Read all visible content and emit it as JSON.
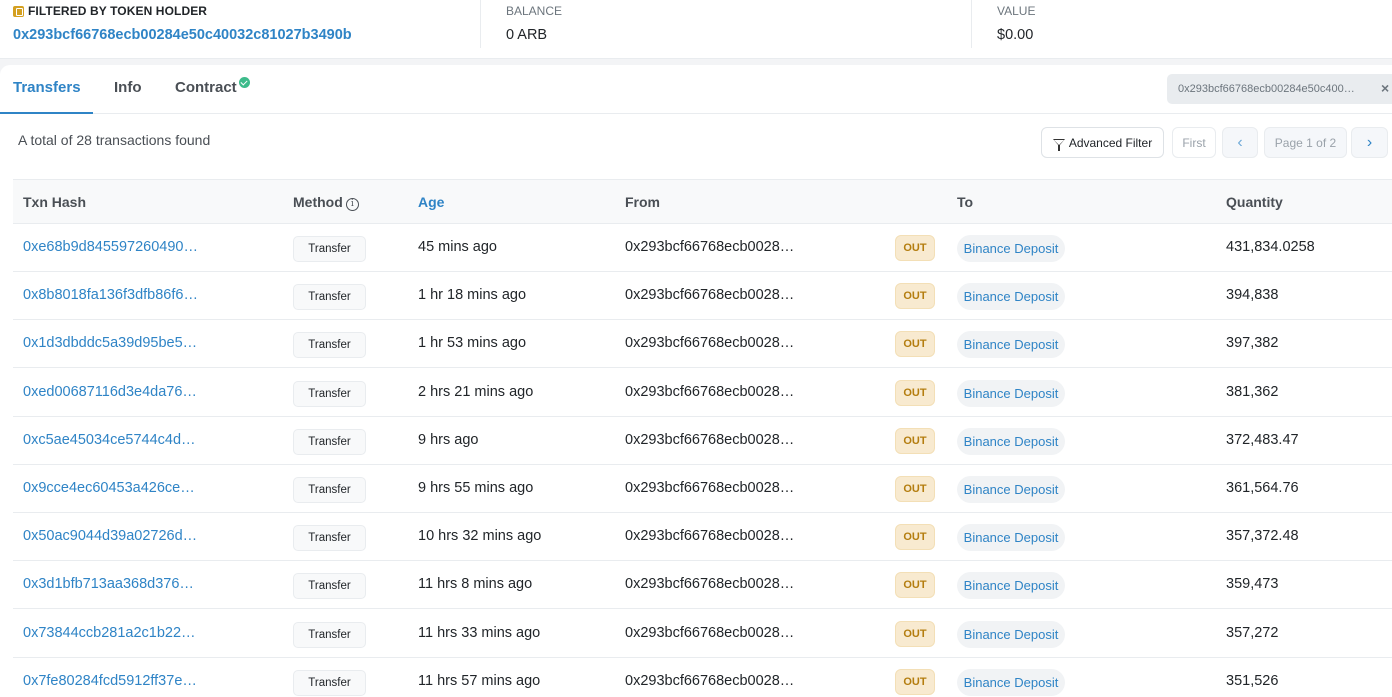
{
  "summary": {
    "holder_label": "FILTERED BY TOKEN HOLDER",
    "holder_address": "0x293bcf66768ecb00284e50c40032c81027b3490b",
    "balance_label": "BALANCE",
    "balance_value": "0 ARB",
    "value_label": "VALUE",
    "value_value": "$0.00"
  },
  "tabs": {
    "transfers": "Transfers",
    "info": "Info",
    "contract": "Contract",
    "active": "Transfers"
  },
  "filter_chip": {
    "text": "0x293bcf66768ecb00284e50c400…",
    "close": "×"
  },
  "toolbar": {
    "total_text": "A total of 28 transactions found",
    "advanced_filter": "Advanced Filter",
    "first": "First",
    "prev": "‹",
    "page": "Page 1 of 2",
    "next": "›"
  },
  "table": {
    "headers": {
      "hash": "Txn Hash",
      "method": "Method",
      "age": "Age",
      "from": "From",
      "to": "To",
      "quantity": "Quantity"
    },
    "rows": [
      {
        "hash": "0xe68b9d845597260490…",
        "method": "Transfer",
        "age": "45 mins ago",
        "from": "0x293bcf66768ecb0028…",
        "dir": "OUT",
        "to": "Binance Deposit",
        "qty": "431,834.0258"
      },
      {
        "hash": "0x8b8018fa136f3dfb86f6…",
        "method": "Transfer",
        "age": "1 hr 18 mins ago",
        "from": "0x293bcf66768ecb0028…",
        "dir": "OUT",
        "to": "Binance Deposit",
        "qty": "394,838"
      },
      {
        "hash": "0x1d3dbddc5a39d95be5…",
        "method": "Transfer",
        "age": "1 hr 53 mins ago",
        "from": "0x293bcf66768ecb0028…",
        "dir": "OUT",
        "to": "Binance Deposit",
        "qty": "397,382"
      },
      {
        "hash": "0xed00687116d3e4da76…",
        "method": "Transfer",
        "age": "2 hrs 21 mins ago",
        "from": "0x293bcf66768ecb0028…",
        "dir": "OUT",
        "to": "Binance Deposit",
        "qty": "381,362"
      },
      {
        "hash": "0xc5ae45034ce5744c4d…",
        "method": "Transfer",
        "age": "9 hrs ago",
        "from": "0x293bcf66768ecb0028…",
        "dir": "OUT",
        "to": "Binance Deposit",
        "qty": "372,483.47"
      },
      {
        "hash": "0x9cce4ec60453a426ce…",
        "method": "Transfer",
        "age": "9 hrs 55 mins ago",
        "from": "0x293bcf66768ecb0028…",
        "dir": "OUT",
        "to": "Binance Deposit",
        "qty": "361,564.76"
      },
      {
        "hash": "0x50ac9044d39a02726d…",
        "method": "Transfer",
        "age": "10 hrs 32 mins ago",
        "from": "0x293bcf66768ecb0028…",
        "dir": "OUT",
        "to": "Binance Deposit",
        "qty": "357,372.48"
      },
      {
        "hash": "0x3d1bfb713aa368d376…",
        "method": "Transfer",
        "age": "11 hrs 8 mins ago",
        "from": "0x293bcf66768ecb0028…",
        "dir": "OUT",
        "to": "Binance Deposit",
        "qty": "359,473"
      },
      {
        "hash": "0x73844ccb281a2c1b22…",
        "method": "Transfer",
        "age": "11 hrs 33 mins ago",
        "from": "0x293bcf66768ecb0028…",
        "dir": "OUT",
        "to": "Binance Deposit",
        "qty": "357,272"
      },
      {
        "hash": "0x7fe80284fcd5912ff37e…",
        "method": "Transfer",
        "age": "11 hrs 57 mins ago",
        "from": "0x293bcf66768ecb0028…",
        "dir": "OUT",
        "to": "Binance Deposit",
        "qty": "351,526"
      }
    ]
  },
  "colors": {
    "link": "#2f84c6",
    "out_badge_bg": "#f8ead0",
    "out_badge_text": "#b47d0f",
    "verified": "#3dbb8b"
  }
}
